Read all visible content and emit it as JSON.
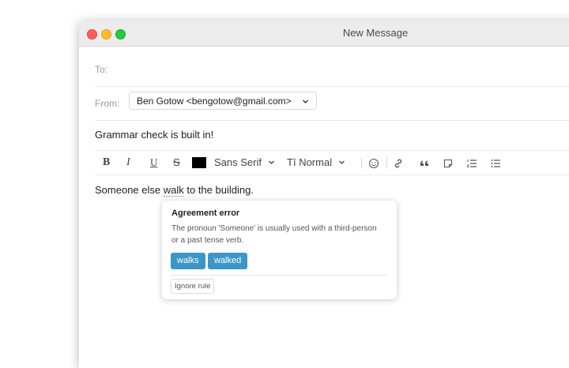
{
  "window": {
    "title": "New Message"
  },
  "compose": {
    "to_label": "To:",
    "from_label": "From:",
    "from_value": "Ben Gotow <bengotow@gmail.com>",
    "subject": "Grammar check is built in!",
    "body_prefix": "Someone else ",
    "body_error_word": "walk",
    "body_suffix": " to the building."
  },
  "toolbar": {
    "bold": "B",
    "italic": "I",
    "underline": "U",
    "strike": "S",
    "text_color": "#000000",
    "font": "Sans Serif",
    "size_glyph": "Tī",
    "size": "Normal",
    "chevron": "⌄",
    "emoji_glyph": "☺",
    "link_glyph": "⚲",
    "quote_glyph": "❝",
    "note_glyph": "▢",
    "ordered_list_glyph": "☰",
    "unordered_list_glyph": "☰",
    "icons": [
      "bold-icon",
      "italic-icon",
      "underline-icon",
      "strikethrough-icon",
      "text-color-icon",
      "emoji-icon",
      "link-icon",
      "quote-icon",
      "note-icon",
      "ordered-list-icon",
      "unordered-list-icon"
    ]
  },
  "grammar_popup": {
    "title": "Agreement error",
    "description": "The pronoun 'Someone' is usually used with a third-person or a past tense verb.",
    "suggestions": [
      "walks",
      "walked"
    ],
    "ignore_label": "Ignore rule",
    "accent_color": "#3b97c8"
  }
}
